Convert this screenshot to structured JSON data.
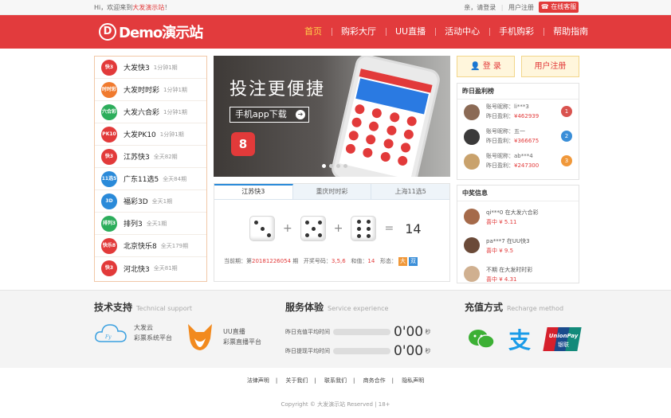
{
  "topbar": {
    "welcome": "Hi，欢迎来到",
    "site": "大发演示站",
    "bang": "！",
    "greeting": "亲，请登录",
    "register": "用户注册",
    "service": "在线客服"
  },
  "header": {
    "logo_text": "Demo演示站",
    "nav": [
      "首页",
      "购彩大厅",
      "UU直播",
      "活动中心",
      "手机购彩",
      "帮助指南"
    ]
  },
  "lottery_list": [
    {
      "name": "大发快3",
      "freq": "1分钟1期",
      "color": "#e23a3a",
      "icon": "快3"
    },
    {
      "name": "大发时时彩",
      "freq": "1分钟1期",
      "color": "#f07a2e",
      "icon": "时时彩"
    },
    {
      "name": "大发六合彩",
      "freq": "1分钟1期",
      "color": "#2cad5b",
      "icon": "六合彩"
    },
    {
      "name": "大发PK10",
      "freq": "1分钟1期",
      "color": "#e23a3a",
      "icon": "PK10"
    },
    {
      "name": "江苏快3",
      "freq": "全天82期",
      "color": "#e23a3a",
      "icon": "快3"
    },
    {
      "name": "广东11选5",
      "freq": "全天84期",
      "color": "#2a8ad9",
      "icon": "11选5"
    },
    {
      "name": "福彩3D",
      "freq": "全天1期",
      "color": "#2a8ad9",
      "icon": "3D"
    },
    {
      "name": "排列3",
      "freq": "全天1期",
      "color": "#2cad5b",
      "icon": "排列3"
    },
    {
      "name": "北京快乐8",
      "freq": "全天179期",
      "color": "#e23a3a",
      "icon": "快乐8"
    },
    {
      "name": "河北快3",
      "freq": "全天81期",
      "color": "#e23a3a",
      "icon": "快3"
    }
  ],
  "banner": {
    "headline": "投注更便捷",
    "download": "手机app下载",
    "download_arrow": "➜",
    "icon_num": "8"
  },
  "draw": {
    "tabs": [
      "江苏快3",
      "重庆时时彩",
      "上海11选5"
    ],
    "plus": "+",
    "equals": "=",
    "sum": "14",
    "period_label": "当前期：第",
    "period": "20181226054",
    "period_unit": "期",
    "result_label": "开奖号码：",
    "result": "3,5,6",
    "sum_label": "和值：",
    "sum_value": "14",
    "shape_label": "形态：",
    "shape_big": "大",
    "shape_even": "双"
  },
  "auth": {
    "login": "登 录",
    "register": "用户注册"
  },
  "ranking": {
    "title": "昨日盈利榜",
    "items": [
      {
        "nick": "账号昵称：li***3",
        "profit_label": "昨日盈利：",
        "profit": "¥462939",
        "rank": "1",
        "color": "#d9534f"
      },
      {
        "nick": "账号昵称：五一",
        "profit_label": "昨日盈利：",
        "profit": "¥366675",
        "rank": "2",
        "color": "#3a8ed8"
      },
      {
        "nick": "账号昵称：ab***4",
        "profit_label": "昨日盈利：",
        "profit": "¥247300",
        "rank": "3",
        "color": "#f0983a"
      }
    ]
  },
  "winners": {
    "title": "中奖信息",
    "items": [
      {
        "line1": "qi***0 在大发六合彩",
        "line2": "喜中 ¥ 5.11"
      },
      {
        "line1": "pa***7 在UU快3",
        "line2": "喜中 ¥ 9.5"
      },
      {
        "line1": "不期 在大发时时彩",
        "line2": "喜中 ¥ 4.31"
      }
    ]
  },
  "support": {
    "title": "技术支持",
    "title_en": "Technical support",
    "items": [
      {
        "name": "大发云",
        "desc": "彩票系统平台"
      },
      {
        "name": "UU直播",
        "desc": "彩票直播平台"
      }
    ]
  },
  "service_exp": {
    "title": "服务体验",
    "title_en": "Service experience",
    "rows": [
      {
        "label": "昨日充值平均时间",
        "value": "0'00",
        "unit": "秒"
      },
      {
        "label": "昨日提现平均时间",
        "value": "0'00",
        "unit": "秒"
      }
    ]
  },
  "recharge": {
    "title": "充值方式",
    "title_en": "Recharge method",
    "unionpay": "UnionPay",
    "unionpay_cn": "银联"
  },
  "footer": {
    "links": [
      "法律声明",
      "关于我们",
      "联系我们",
      "商务合作",
      "隐私声明"
    ],
    "divider": "|",
    "copyright": "Copyright © 大发演示站 Reserved | 18+"
  }
}
